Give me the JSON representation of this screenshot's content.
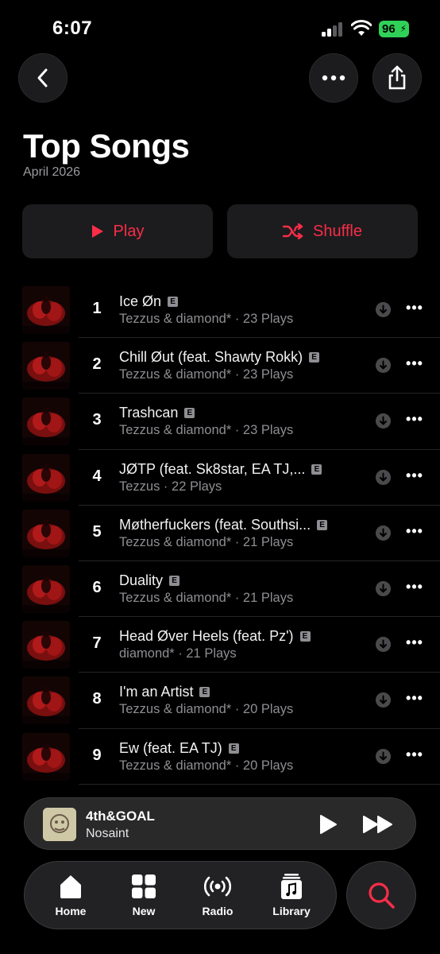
{
  "status": {
    "time": "6:07",
    "battery": "96"
  },
  "nav": {
    "back_icon": "chevron-left-icon",
    "more_icon": "ellipsis-icon",
    "share_icon": "share-icon"
  },
  "header": {
    "title": "Top Songs",
    "subtitle": "April 2026"
  },
  "actions": {
    "play_label": "Play",
    "shuffle_label": "Shuffle",
    "accent": "#fa2d48"
  },
  "songs": [
    {
      "rank": "1",
      "title": "Ice Øn",
      "subtitle": "Tezzus & diamond* · 23 Plays",
      "explicit": "E"
    },
    {
      "rank": "2",
      "title": "Chill Øut (feat. Shawty Rokk)",
      "subtitle": "Tezzus & diamond* · 23 Plays",
      "explicit": "E"
    },
    {
      "rank": "3",
      "title": "Trashcan",
      "subtitle": "Tezzus & diamond* · 23 Plays",
      "explicit": "E"
    },
    {
      "rank": "4",
      "title": "JØTP (feat. Sk8star,  EA TJ,...",
      "subtitle": "Tezzus · 22 Plays",
      "explicit": "E"
    },
    {
      "rank": "5",
      "title": "Møtherfuckers (feat. Southsi...",
      "subtitle": "Tezzus & diamond* · 21 Plays",
      "explicit": "E"
    },
    {
      "rank": "6",
      "title": "Duality",
      "subtitle": "Tezzus & diamond* · 21 Plays",
      "explicit": "E"
    },
    {
      "rank": "7",
      "title": "Head Øver Heels (feat. Pz')",
      "subtitle": "diamond* · 21 Plays",
      "explicit": "E"
    },
    {
      "rank": "8",
      "title": "I'm an Artist",
      "subtitle": "Tezzus & diamond* · 20 Plays",
      "explicit": "E"
    },
    {
      "rank": "9",
      "title": "Ew (feat. EA TJ)",
      "subtitle": "Tezzus & diamond* · 20 Plays",
      "explicit": "E"
    }
  ],
  "row_more_glyph": "•••",
  "mini_player": {
    "title": "4th&GOAL",
    "artist": "Nosaint"
  },
  "tabs": {
    "home": "Home",
    "new": "New",
    "radio": "Radio",
    "library": "Library"
  }
}
